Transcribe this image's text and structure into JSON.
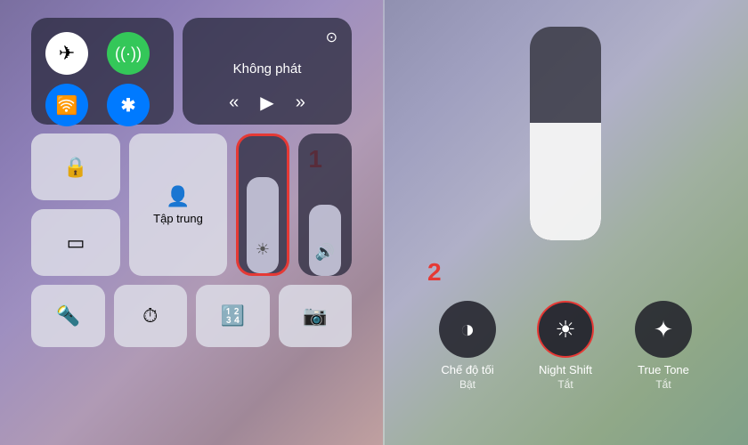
{
  "left": {
    "connectivity": {
      "airplane": "✈",
      "cellular": "📶",
      "wifi": "📶",
      "bluetooth": "✦"
    },
    "media": {
      "title": "Không phát",
      "airplay": "⊙",
      "prev": "«",
      "play": "▶",
      "next": "»"
    },
    "smallBtns": {
      "lock": "🔒",
      "mirror": "▭"
    },
    "focus": {
      "icon": "👤",
      "label": "Tập trung"
    },
    "step1": "1",
    "sliderIcon": "☀",
    "volumeIcon": "🔊",
    "bottom": {
      "flashlight": "🔦",
      "timer": "⏱",
      "calculator": "⌨",
      "camera": "📷"
    }
  },
  "right": {
    "step2": "2",
    "icons": [
      {
        "id": "dark-mode",
        "icon": "◑",
        "label": "Chế độ tối",
        "sublabel": "Bật"
      },
      {
        "id": "night-shift",
        "icon": "☀",
        "label": "Night Shift",
        "sublabel": "Tắt",
        "highlighted": true
      },
      {
        "id": "true-tone",
        "icon": "✦",
        "label": "True Tone",
        "sublabel": "Tắt"
      }
    ]
  }
}
